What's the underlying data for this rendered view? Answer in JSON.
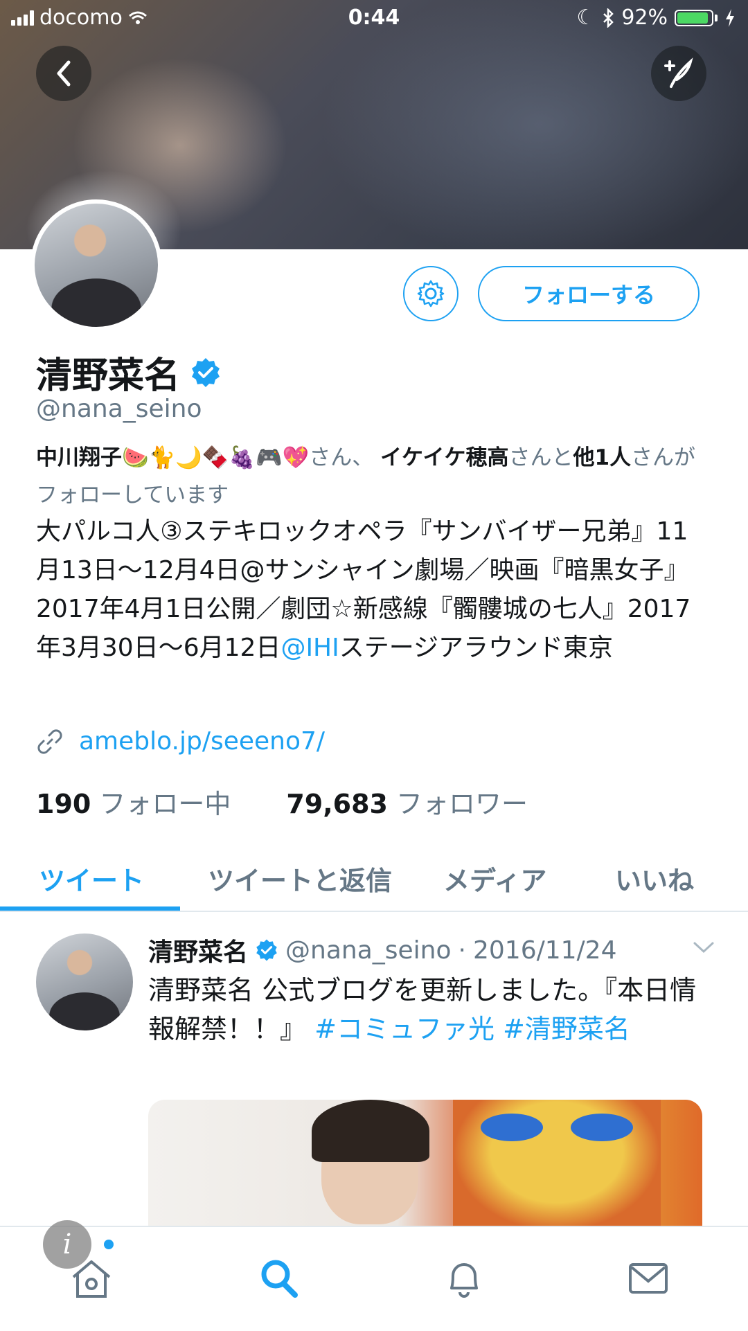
{
  "status_bar": {
    "carrier": "docomo",
    "time": "0:44",
    "battery": "92%",
    "battery_level": 0.92
  },
  "header": {
    "back_icon": "chevron-left-icon",
    "compose_icon": "compose-tweet-icon"
  },
  "profile": {
    "name": "清野菜名",
    "handle": "@nana_seino",
    "follow_label": "フォローする",
    "settings_icon": "gear-icon",
    "followed_by": {
      "user1": "中川翔子🍉🐈🌙🍫🍇🎮💖",
      "sep1": "さん、",
      "user2": "イケイケ穂高",
      "sep2": "さんと",
      "others": "他1人",
      "suffix": "さんがフォローしています"
    },
    "bio": {
      "before": "大パルコ人③ステキロックオペラ『サンバイザー兄弟』11月13日〜12月4日@サンシャイン劇場／映画『暗黒女子』2017年4月1日公開／劇団☆新感線『髑髏城の七人』2017年3月30日〜6月12日",
      "mention": "@IHI",
      "after": "ステージアラウンド東京"
    },
    "link": "ameblo.jp/seeeno7/",
    "following_count": "190",
    "following_label": "フォロー中",
    "followers_count": "79,683",
    "followers_label": "フォロワー"
  },
  "tabs": [
    {
      "label": "ツイート",
      "active": true
    },
    {
      "label": "ツイートと返信",
      "active": false
    },
    {
      "label": "メディア",
      "active": false
    },
    {
      "label": "いいね",
      "active": false
    }
  ],
  "tweet": {
    "name": "清野菜名",
    "handle": "@nana_seino",
    "dot": "·",
    "date": "2016/11/24",
    "text": "清野菜名 公式ブログを更新しました。『本日情報解禁！！』",
    "hashtag1": "#コミュファ光",
    "hashtag2": "#清野菜名"
  },
  "tab_bar": {
    "items": [
      "home-icon",
      "search-icon",
      "bell-icon",
      "mail-icon"
    ],
    "info_badge": "i"
  },
  "colors": {
    "accent": "#1da1f2",
    "text": "#14171a",
    "muted": "#657786"
  }
}
